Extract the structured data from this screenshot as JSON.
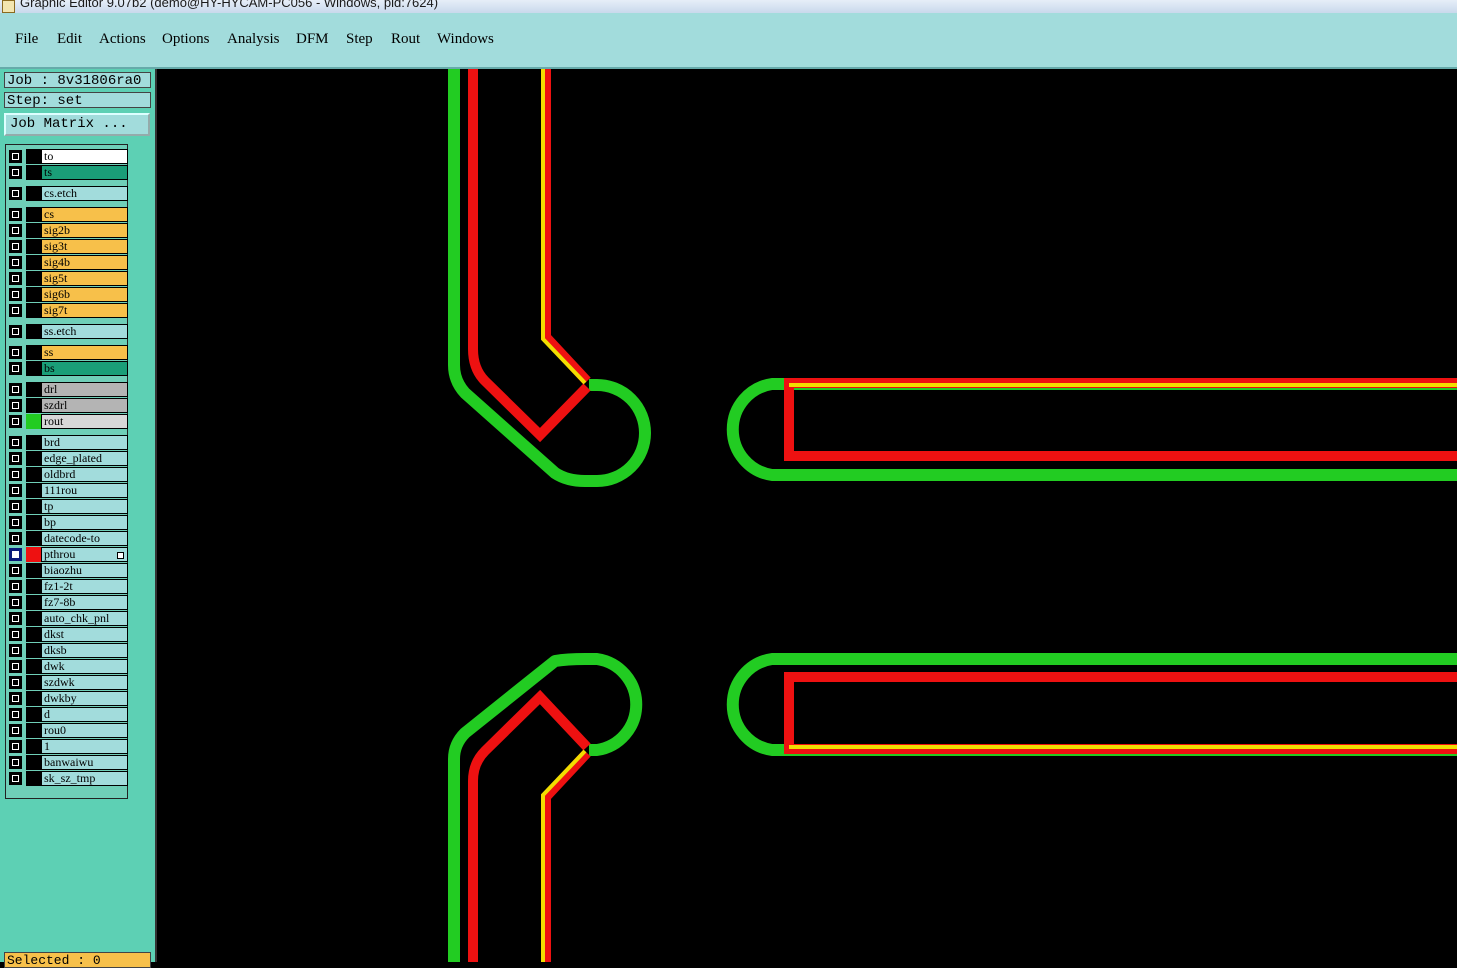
{
  "window": {
    "title": "Graphic Editor 9.07b2 (demo@HY-HYCAM-PC056 - Windows, pid:7624)"
  },
  "menu": [
    {
      "label": "File"
    },
    {
      "label": "Edit"
    },
    {
      "label": "Actions"
    },
    {
      "label": "Options"
    },
    {
      "label": "Analysis"
    },
    {
      "label": "DFM"
    },
    {
      "label": "Step"
    },
    {
      "label": "Rout"
    },
    {
      "label": "Windows"
    }
  ],
  "info": {
    "job": "Job : 8v31806ra0",
    "step": "Step: set",
    "job_matrix_button": "Job Matrix ..."
  },
  "layers": [
    {
      "name": "to",
      "color": "#ffffff"
    },
    {
      "name": "ts",
      "color": "#1a9e78"
    },
    {
      "name": "cs.etch",
      "color": "#a2dcdc"
    },
    {
      "name": "cs",
      "color": "#f7c04a"
    },
    {
      "name": "sig2b",
      "color": "#f7c04a"
    },
    {
      "name": "sig3t",
      "color": "#f7c04a"
    },
    {
      "name": "sig4b",
      "color": "#f7c04a"
    },
    {
      "name": "sig5t",
      "color": "#f7c04a"
    },
    {
      "name": "sig6b",
      "color": "#f7c04a"
    },
    {
      "name": "sig7t",
      "color": "#f7c04a"
    },
    {
      "name": "ss.etch",
      "color": "#a2dcdc"
    },
    {
      "name": "ss",
      "color": "#f7c04a"
    },
    {
      "name": "bs",
      "color": "#1a9e78"
    },
    {
      "name": "drl",
      "color": "#b4b4b4"
    },
    {
      "name": "szdrl",
      "color": "#b4b4b4"
    },
    {
      "name": "rout",
      "color": "#d8d8d8",
      "swatch": "#22cc22"
    },
    {
      "name": "brd",
      "color": "#a2dcdc"
    },
    {
      "name": "edge_plated",
      "color": "#a2dcdc"
    },
    {
      "name": "oldbrd",
      "color": "#a2dcdc"
    },
    {
      "name": "111rou",
      "color": "#a2dcdc"
    },
    {
      "name": "tp",
      "color": "#a2dcdc"
    },
    {
      "name": "bp",
      "color": "#a2dcdc"
    },
    {
      "name": "datecode-to",
      "color": "#a2dcdc"
    },
    {
      "name": "pthrou",
      "color": "#a2dcdc",
      "swatch": "#ee1111",
      "selected": true
    },
    {
      "name": "biaozhu",
      "color": "#a2dcdc"
    },
    {
      "name": "fz1-2t",
      "color": "#a2dcdc"
    },
    {
      "name": "fz7-8b",
      "color": "#a2dcdc"
    },
    {
      "name": "auto_chk_pnl",
      "color": "#a2dcdc"
    },
    {
      "name": "dkst",
      "color": "#a2dcdc"
    },
    {
      "name": "dksb",
      "color": "#a2dcdc"
    },
    {
      "name": "dwk",
      "color": "#a2dcdc"
    },
    {
      "name": "szdwk",
      "color": "#a2dcdc"
    },
    {
      "name": "dwkby",
      "color": "#a2dcdc"
    },
    {
      "name": "d",
      "color": "#a2dcdc"
    },
    {
      "name": "rou0",
      "color": "#a2dcdc"
    },
    {
      "name": "1",
      "color": "#a2dcdc"
    },
    {
      "name": "banwaiwu",
      "color": "#a2dcdc"
    },
    {
      "name": "sk_sz_tmp",
      "color": "#a2dcdc"
    }
  ],
  "status": {
    "selected": "Selected : 0"
  },
  "colors": {
    "rout": "#22cc22",
    "pthrou": "#ee1111",
    "overlap": "#f2dd00"
  }
}
